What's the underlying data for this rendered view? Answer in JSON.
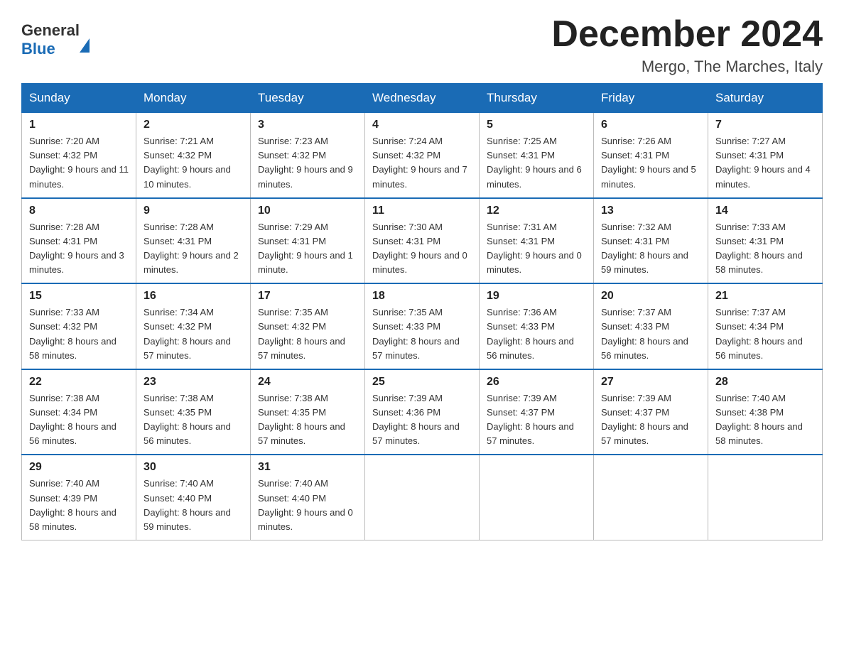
{
  "logo": {
    "text_general": "General",
    "text_blue": "Blue"
  },
  "title": "December 2024",
  "location": "Mergo, The Marches, Italy",
  "headers": [
    "Sunday",
    "Monday",
    "Tuesday",
    "Wednesday",
    "Thursday",
    "Friday",
    "Saturday"
  ],
  "weeks": [
    [
      {
        "day": "1",
        "sunrise": "7:20 AM",
        "sunset": "4:32 PM",
        "daylight": "9 hours and 11 minutes."
      },
      {
        "day": "2",
        "sunrise": "7:21 AM",
        "sunset": "4:32 PM",
        "daylight": "9 hours and 10 minutes."
      },
      {
        "day": "3",
        "sunrise": "7:23 AM",
        "sunset": "4:32 PM",
        "daylight": "9 hours and 9 minutes."
      },
      {
        "day": "4",
        "sunrise": "7:24 AM",
        "sunset": "4:32 PM",
        "daylight": "9 hours and 7 minutes."
      },
      {
        "day": "5",
        "sunrise": "7:25 AM",
        "sunset": "4:31 PM",
        "daylight": "9 hours and 6 minutes."
      },
      {
        "day": "6",
        "sunrise": "7:26 AM",
        "sunset": "4:31 PM",
        "daylight": "9 hours and 5 minutes."
      },
      {
        "day": "7",
        "sunrise": "7:27 AM",
        "sunset": "4:31 PM",
        "daylight": "9 hours and 4 minutes."
      }
    ],
    [
      {
        "day": "8",
        "sunrise": "7:28 AM",
        "sunset": "4:31 PM",
        "daylight": "9 hours and 3 minutes."
      },
      {
        "day": "9",
        "sunrise": "7:28 AM",
        "sunset": "4:31 PM",
        "daylight": "9 hours and 2 minutes."
      },
      {
        "day": "10",
        "sunrise": "7:29 AM",
        "sunset": "4:31 PM",
        "daylight": "9 hours and 1 minute."
      },
      {
        "day": "11",
        "sunrise": "7:30 AM",
        "sunset": "4:31 PM",
        "daylight": "9 hours and 0 minutes."
      },
      {
        "day": "12",
        "sunrise": "7:31 AM",
        "sunset": "4:31 PM",
        "daylight": "9 hours and 0 minutes."
      },
      {
        "day": "13",
        "sunrise": "7:32 AM",
        "sunset": "4:31 PM",
        "daylight": "8 hours and 59 minutes."
      },
      {
        "day": "14",
        "sunrise": "7:33 AM",
        "sunset": "4:31 PM",
        "daylight": "8 hours and 58 minutes."
      }
    ],
    [
      {
        "day": "15",
        "sunrise": "7:33 AM",
        "sunset": "4:32 PM",
        "daylight": "8 hours and 58 minutes."
      },
      {
        "day": "16",
        "sunrise": "7:34 AM",
        "sunset": "4:32 PM",
        "daylight": "8 hours and 57 minutes."
      },
      {
        "day": "17",
        "sunrise": "7:35 AM",
        "sunset": "4:32 PM",
        "daylight": "8 hours and 57 minutes."
      },
      {
        "day": "18",
        "sunrise": "7:35 AM",
        "sunset": "4:33 PM",
        "daylight": "8 hours and 57 minutes."
      },
      {
        "day": "19",
        "sunrise": "7:36 AM",
        "sunset": "4:33 PM",
        "daylight": "8 hours and 56 minutes."
      },
      {
        "day": "20",
        "sunrise": "7:37 AM",
        "sunset": "4:33 PM",
        "daylight": "8 hours and 56 minutes."
      },
      {
        "day": "21",
        "sunrise": "7:37 AM",
        "sunset": "4:34 PM",
        "daylight": "8 hours and 56 minutes."
      }
    ],
    [
      {
        "day": "22",
        "sunrise": "7:38 AM",
        "sunset": "4:34 PM",
        "daylight": "8 hours and 56 minutes."
      },
      {
        "day": "23",
        "sunrise": "7:38 AM",
        "sunset": "4:35 PM",
        "daylight": "8 hours and 56 minutes."
      },
      {
        "day": "24",
        "sunrise": "7:38 AM",
        "sunset": "4:35 PM",
        "daylight": "8 hours and 57 minutes."
      },
      {
        "day": "25",
        "sunrise": "7:39 AM",
        "sunset": "4:36 PM",
        "daylight": "8 hours and 57 minutes."
      },
      {
        "day": "26",
        "sunrise": "7:39 AM",
        "sunset": "4:37 PM",
        "daylight": "8 hours and 57 minutes."
      },
      {
        "day": "27",
        "sunrise": "7:39 AM",
        "sunset": "4:37 PM",
        "daylight": "8 hours and 57 minutes."
      },
      {
        "day": "28",
        "sunrise": "7:40 AM",
        "sunset": "4:38 PM",
        "daylight": "8 hours and 58 minutes."
      }
    ],
    [
      {
        "day": "29",
        "sunrise": "7:40 AM",
        "sunset": "4:39 PM",
        "daylight": "8 hours and 58 minutes."
      },
      {
        "day": "30",
        "sunrise": "7:40 AM",
        "sunset": "4:40 PM",
        "daylight": "8 hours and 59 minutes."
      },
      {
        "day": "31",
        "sunrise": "7:40 AM",
        "sunset": "4:40 PM",
        "daylight": "9 hours and 0 minutes."
      },
      null,
      null,
      null,
      null
    ]
  ]
}
